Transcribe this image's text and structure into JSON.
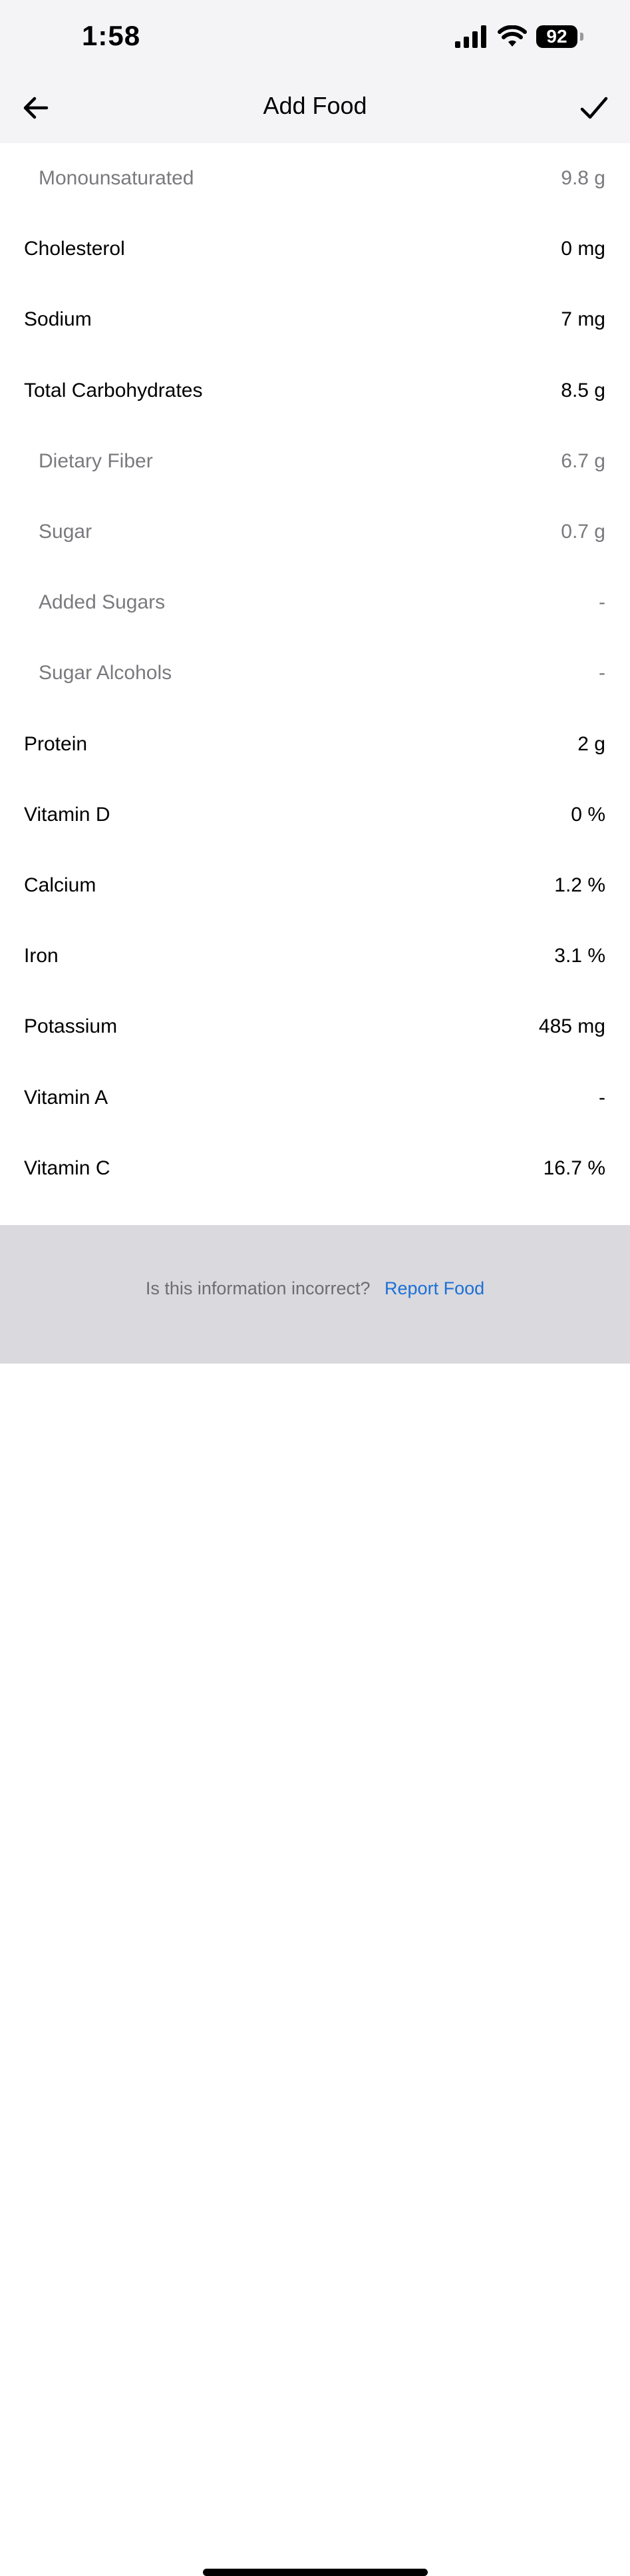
{
  "status_bar": {
    "time": "1:58",
    "battery": "92",
    "icons": [
      "cellular-signal-icon",
      "wifi-icon",
      "battery-icon"
    ]
  },
  "nav": {
    "title": "Add Food",
    "back_icon": "arrow-left-icon",
    "done_icon": "checkmark-icon"
  },
  "nutrients": [
    {
      "label": "Monounsaturated",
      "value": "9.8 g",
      "sub": true
    },
    {
      "label": "Cholesterol",
      "value": "0 mg",
      "sub": false
    },
    {
      "label": "Sodium",
      "value": "7 mg",
      "sub": false
    },
    {
      "label": "Total Carbohydrates",
      "value": "8.5 g",
      "sub": false
    },
    {
      "label": "Dietary Fiber",
      "value": "6.7 g",
      "sub": true
    },
    {
      "label": "Sugar",
      "value": "0.7 g",
      "sub": true
    },
    {
      "label": "Added Sugars",
      "value": "-",
      "sub": true
    },
    {
      "label": "Sugar Alcohols",
      "value": "-",
      "sub": true
    },
    {
      "label": "Protein",
      "value": "2 g",
      "sub": false
    },
    {
      "label": "Vitamin D",
      "value": "0 %",
      "sub": false
    },
    {
      "label": "Calcium",
      "value": "1.2 %",
      "sub": false
    },
    {
      "label": "Iron",
      "value": "3.1 %",
      "sub": false
    },
    {
      "label": "Potassium",
      "value": "485 mg",
      "sub": false
    },
    {
      "label": "Vitamin A",
      "value": "-",
      "sub": false
    },
    {
      "label": "Vitamin C",
      "value": "16.7 %",
      "sub": false
    }
  ],
  "footer": {
    "question": "Is this information incorrect?",
    "link": "Report Food"
  },
  "colors": {
    "header_bg": "#f4f4f6",
    "footer_bg": "#d9d9de",
    "link": "#1c6fd6",
    "sub_text": "#7a7a7e"
  }
}
